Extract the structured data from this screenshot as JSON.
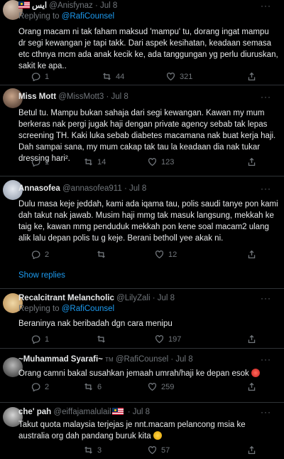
{
  "tweets": [
    {
      "name": "ايس",
      "handle": "@Anisfynaz",
      "time": "· Jul 8",
      "replying_prefix": "Replying to",
      "replying_to": "@RafiCounsel",
      "text": "Orang macam ni tak faham maksud 'mampu' tu, dorang ingat mampu dr segi kewangan je tapi takk. Dari aspek kesihatan, keadaan semasa etc cthnya mcm ada anak kecik ke, ada tanggungan yg perlu diuruskan, sakit ke apa..",
      "reply_count": "1",
      "retweet_count": "44",
      "like_count": "321"
    },
    {
      "name": "Miss Mott",
      "handle": "@MissMott3",
      "time": "· Jul 8",
      "text": "Betul tu. Mampu bukan sahaja dari segi kewangan. Kawan my mum berkeras nak pergi jugak haji dengan private agency sebab tak lepas screening TH. Kaki luka sebab diabetes macamana nak buat kerja haji. Dah sampai sana, my mum cakap tak tau la keadaan dia nak tukar dressing hari².",
      "reply_count": "1",
      "retweet_count": "14",
      "like_count": "123"
    },
    {
      "name": "Annasofea",
      "handle": "@annasofea911",
      "time": "· Jul 8",
      "text": "Dulu masa keje jeddah, kami ada iqama tau, polis saudi tanye pon kami dah takut nak jawab. Musim haji mmg tak masuk langsung, mekkah ke taig ke, kawan mmg penduduk mekkah pon kene soal macam2 ulang alik lalu depan polis tu g keje. Berani betholl yee akak ni.",
      "reply_count": "2",
      "retweet_count": "",
      "like_count": "12",
      "show_replies": "Show replies"
    },
    {
      "name": "Recalcitrant Melancholic",
      "handle": "@LilyZali",
      "time": "· Jul 8",
      "replying_prefix": "Replying to",
      "replying_to": "@RafiCounsel",
      "text": "Beraninya nak beribadah dgn cara menipu",
      "reply_count": "1",
      "retweet_count": "",
      "like_count": "197"
    },
    {
      "name": "~Muhammad Syarafi~",
      "tm": "TM",
      "handle": "@RafiCounsel",
      "time": "· Jul 8",
      "text": "Orang camni bakal susahkan jemaah umrah/haji ke depan esok",
      "reply_count": "2",
      "retweet_count": "6",
      "like_count": "259"
    },
    {
      "name": "che' pah",
      "handle": "@eiffajamalulail",
      "time": "· Jul 8",
      "text": "Takut quota malaysia terjejas je nnt.macam pelancong msia ke australia org dah pandang buruk kita",
      "reply_count": "",
      "retweet_count": "3",
      "like_count": "57"
    }
  ],
  "colors": {
    "background": "#000000",
    "text": "#e7e9ea",
    "muted": "#71767b",
    "link": "#1d9bf0",
    "divider": "#2f3336"
  },
  "icons": [
    "reply-icon",
    "retweet-icon",
    "like-icon",
    "share-icon",
    "more-icon",
    "malaysia-flag-icon",
    "angry-emoji-icon",
    "worried-emoji-icon"
  ]
}
